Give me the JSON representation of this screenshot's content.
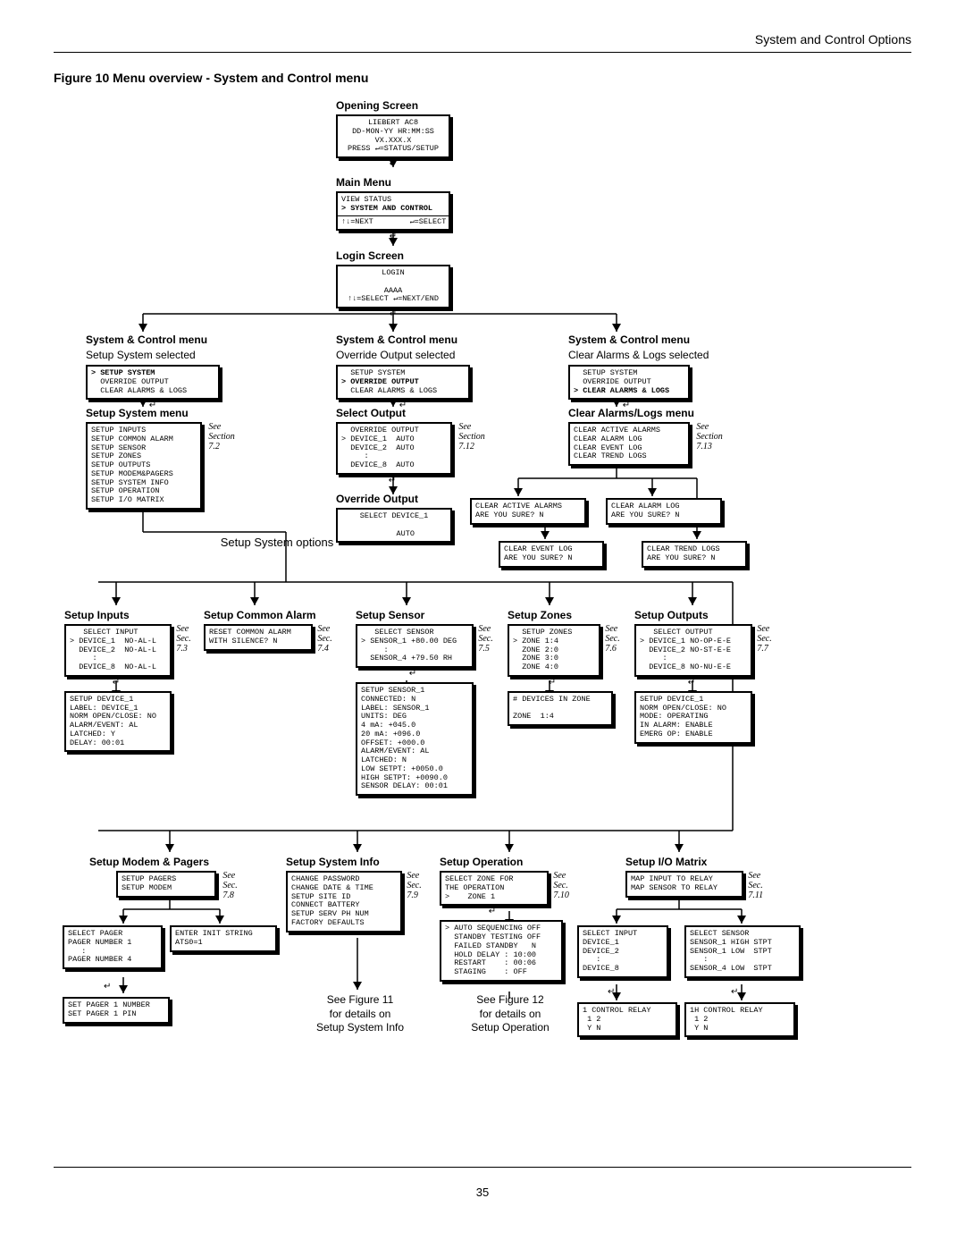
{
  "page": {
    "header": "System and Control Options",
    "figure_title": "Figure 10   Menu overview - System and Control menu",
    "page_number": "35"
  },
  "opening": {
    "title": "Opening Screen",
    "l1": "LIEBERT AC8",
    "l2": "DD-MON-YY HR:MM:SS",
    "l3": "VX.XXX.X",
    "l4": "PRESS ↵=STATUS/SETUP"
  },
  "enter": "↵",
  "main_menu": {
    "title": "Main Menu",
    "l1": "VIEW STATUS",
    "l2": "> SYSTEM AND CONTROL",
    "foot": "↑↓=NEXT        ↵=SELECT"
  },
  "login": {
    "title": "Login Screen",
    "l1": "LOGIN",
    "l2": "AAAA",
    "l3": "↑↓=SELECT ↵=NEXT/END"
  },
  "scm1": {
    "title": "System & Control menu",
    "sub": "Setup System selected",
    "l1": "> SETUP SYSTEM",
    "l2": "  OVERRIDE OUTPUT",
    "l3": "  CLEAR ALARMS & LOGS"
  },
  "scm2": {
    "title": "System & Control menu",
    "sub": "Override Output selected",
    "l1": "  SETUP SYSTEM",
    "l2": "> OVERRIDE OUTPUT",
    "l3": "  CLEAR ALARMS & LOGS"
  },
  "scm3": {
    "title": "System & Control menu",
    "sub": "Clear Alarms & Logs selected",
    "l1": "  SETUP SYSTEM",
    "l2": "  OVERRIDE OUTPUT",
    "l3": "> CLEAR ALARMS & LOGS"
  },
  "setup_system": {
    "title": "Setup System menu",
    "lines": "SETUP INPUTS\nSETUP COMMON ALARM\nSETUP SENSOR\nSETUP ZONES\nSETUP OUTPUTS\nSETUP MODEM&PAGERS\nSETUP SYSTEM INFO\nSETUP OPERATION\nSETUP I/O MATRIX",
    "ref": "See\nSection\n7.2"
  },
  "select_output": {
    "title": "Select Output",
    "lines": "  OVERRIDE OUTPUT\n> DEVICE_1  AUTO\n  DEVICE_2  AUTO\n     :\n  DEVICE_8  AUTO",
    "ref": "See\nSection\n7.12"
  },
  "override_output": {
    "title": "Override Output",
    "lines": "SELECT DEVICE_1\n\n     AUTO"
  },
  "clear_alarms_menu": {
    "title": "Clear Alarms/Logs menu",
    "lines": "CLEAR ACTIVE ALARMS\nCLEAR ALARM LOG\nCLEAR EVENT LOG\nCLEAR TREND LOGS",
    "ref": "See\nSection\n7.13"
  },
  "ask_active": "CLEAR ACTIVE ALARMS\nARE YOU SURE? N",
  "ask_alarm": "CLEAR ALARM LOG\nARE YOU SURE? N",
  "ask_event": "CLEAR EVENT LOG\nARE YOU SURE? N",
  "ask_trend": "CLEAR TREND LOGS\nARE YOU SURE? N",
  "setup_options_label": "Setup System options",
  "inputs": {
    "title": "Setup Inputs",
    "lines": "   SELECT INPUT\n> DEVICE_1  NO-AL-L\n  DEVICE_2  NO-AL-L\n     :\n  DEVICE_8  NO-AL-L",
    "ref": "See\nSec.\n7.3",
    "detail": "SETUP DEVICE_1\nLABEL: DEVICE_1\nNORM OPEN/CLOSE: NO\nALARM/EVENT: AL\nLATCHED: Y\nDELAY: 00:01"
  },
  "common_alarm": {
    "title": "Setup Common Alarm",
    "lines": "RESET COMMON ALARM\nWITH SILENCE? N",
    "ref": "See\nSec.\n7.4"
  },
  "sensor": {
    "title": "Setup Sensor",
    "lines": "   SELECT SENSOR\n> SENSOR_1 +80.00 DEG\n     :\n  SENSOR_4 +79.50 RH",
    "ref": "See\nSec.\n7.5",
    "detail": "SETUP SENSOR_1\nCONNECTED: N\nLABEL: SENSOR_1\nUNITS: DEG\n4 mA: +045.0\n20 mA: +096.0\nOFFSET: +000.0\nALARM/EVENT: AL\nLATCHED: N\nLOW SETPT: +0050.0\nHIGH SETPT: +0090.0\nSENSOR DELAY: 00:01"
  },
  "zones": {
    "title": "Setup Zones",
    "lines": "  SETUP ZONES\n> ZONE 1:4\n  ZONE 2:0\n  ZONE 3:0\n  ZONE 4:0",
    "ref": "See\nSec.\n7.6",
    "detail": "# DEVICES IN ZONE\n\nZONE  1:4"
  },
  "outputs": {
    "title": "Setup Outputs",
    "lines": "   SELECT OUTPUT\n> DEVICE_1 NO-OP-E-E\n  DEVICE_2 NO-ST-E-E\n     :\n  DEVICE_8 NO-NU-E-E",
    "ref": "See\nSec.\n7.7",
    "detail": "SETUP DEVICE_1\nNORM OPEN/CLOSE: NO\nMODE: OPERATING\nIN ALARM: ENABLE\nEMERG OP: ENABLE"
  },
  "modem": {
    "title": "Setup Modem & Pagers",
    "lines": "SETUP PAGERS\nSETUP MODEM",
    "ref": "See\nSec.\n7.8",
    "select_pager": "SELECT PAGER\nPAGER NUMBER 1\n   :\nPAGER NUMBER 4",
    "init_string": "ENTER INIT STRING\nATS0=1",
    "set_pager": "SET PAGER 1 NUMBER\nSET PAGER 1 PIN"
  },
  "sysinfo": {
    "title": "Setup System Info",
    "lines": "CHANGE PASSWORD\nCHANGE DATE & TIME\nSETUP SITE ID\nCONNECT BATTERY\nSETUP SERV PH NUM\nFACTORY DEFAULTS",
    "ref": "See\nSec.\n7.9",
    "see": "See Figure 11\nfor details on\nSetup System Info"
  },
  "operation": {
    "title": "Setup Operation",
    "lines": "SELECT ZONE FOR\nTHE OPERATION\n>    ZONE 1",
    "ref": "See\nSec.\n7.10",
    "detail": "> AUTO SEQUENCING OFF\n  STANDBY TESTING OFF\n  FAILED STANDBY   N\n  HOLD DELAY : 10:00\n  RESTART    : 00:06\n  STAGING    : OFF",
    "see": "See Figure 12\nfor details on\nSetup Operation"
  },
  "iomatrix": {
    "title": "Setup I/O Matrix",
    "lines": "MAP INPUT TO RELAY\nMAP SENSOR TO RELAY",
    "ref": "See\nSec.\n7.11",
    "sel_input": "SELECT INPUT\nDEVICE_1\nDEVICE_2\n   :\nDEVICE_8",
    "sel_sensor": "SELECT SENSOR\nSENSOR_1 HIGH STPT\nSENSOR_1 LOW  STPT\n   :\nSENSOR_4 LOW  STPT",
    "ctrl_relay_a": "1 CONTROL RELAY\n 1 2\n Y N",
    "ctrl_relay_b": "1H CONTROL RELAY\n 1 2\n Y N"
  }
}
